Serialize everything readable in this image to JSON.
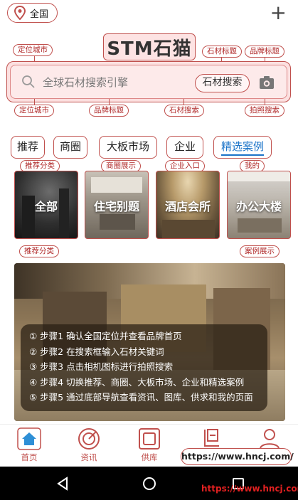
{
  "header": {
    "location_label": "全国",
    "plus_icon": "plus-icon",
    "logo_text": "STM石猫"
  },
  "search": {
    "placeholder": "全球石材搜索引擎",
    "button_label": "石材搜索"
  },
  "annotations": {
    "top_left": "定位城市",
    "top_mid": "石材标题",
    "top_right": "品牌标题",
    "bottom_1": "定位城市",
    "bottom_2": "品牌标题",
    "bottom_3": "石材搜索",
    "bottom_4": "拍照搜索",
    "tab_1": "推荐分类",
    "tab_3": "商圈展示",
    "tab_4": "企业入口",
    "tab_5": "我的",
    "card_left": "推荐分类",
    "card_right": "案例展示"
  },
  "tabs": [
    {
      "label": "推荐"
    },
    {
      "label": "商圈"
    },
    {
      "label": "大板市场"
    },
    {
      "label": "企业"
    },
    {
      "label": "精选案例"
    }
  ],
  "cards": [
    {
      "label": "全部"
    },
    {
      "label": "住宅别题"
    },
    {
      "label": "酒店会所"
    },
    {
      "label": "办公大楼"
    }
  ],
  "steps": [
    "① 步骤1 确认全国定位并查看品牌首页",
    "② 步骤2 在搜索框输入石材关键词",
    "③ 步骤3 点击相机图标进行拍照搜索",
    "④ 步骤4 切换推荐、商圈、大板市场、企业和精选案例",
    "⑤ 步骤5 通过底部导航查看资讯、图库、供求和我的页面"
  ],
  "bottom_nav": [
    {
      "label": "首页",
      "icon": "home-icon"
    },
    {
      "label": "资讯",
      "icon": "news-icon"
    },
    {
      "label": "供库",
      "icon": "gallery-icon"
    },
    {
      "label": "",
      "icon": "supply-icon"
    },
    {
      "label": "",
      "icon": "user-icon"
    }
  ],
  "watermark": {
    "url_pill": "https://www.hncj.com/",
    "url_red": "https://www.hncj.com/"
  },
  "colors": {
    "accent_red": "#c0504d",
    "active_blue": "#1a73c8"
  }
}
